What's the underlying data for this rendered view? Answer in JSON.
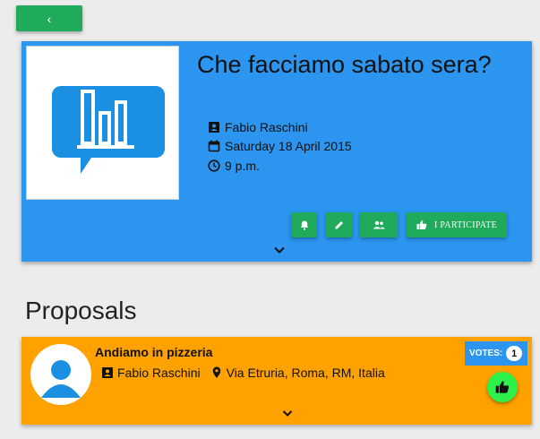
{
  "nav": {
    "back_icon": "chevron-left-icon",
    "back_glyph": "‹"
  },
  "event": {
    "image_icon": "bar-chart-speech-bubble-icon",
    "title": "Che facciamo sabato sera?",
    "organizer": "Fabio Raschini",
    "date": "Saturday 18 April 2015",
    "time": "9 p.m.",
    "actions": [
      {
        "icon": "bell-icon"
      },
      {
        "icon": "pencil-icon"
      },
      {
        "icon": "people-icon"
      },
      {
        "icon": "thumb-up-icon",
        "label": "I PARTICIPATE"
      }
    ]
  },
  "proposals": {
    "section_title": "Proposals",
    "items": [
      {
        "title": "Andiamo in pizzeria",
        "author": "Fabio Raschini",
        "location": "Via Etruria, Roma, RM, Italia",
        "votes_label": "VOTES:",
        "votes_count": "1"
      }
    ]
  },
  "colors": {
    "accent_green": "#1faa5c",
    "event_blue": "#2b95f0",
    "proposal_orange": "#ffa200",
    "vote_green": "#2ef04a"
  }
}
